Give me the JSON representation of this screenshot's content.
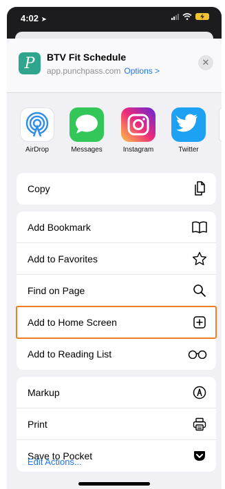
{
  "status": {
    "time": "4:02"
  },
  "header": {
    "title": "BTV Fit Schedule",
    "url": "app.punchpass.com",
    "options": "Options >",
    "app_glyph": "P",
    "close": "✕"
  },
  "share_apps": [
    {
      "label": "AirDrop",
      "icon": "airdrop-icon"
    },
    {
      "label": "Messages",
      "icon": "messages-icon"
    },
    {
      "label": "Instagram",
      "icon": "instagram-icon"
    },
    {
      "label": "Twitter",
      "icon": "twitter-icon"
    }
  ],
  "groups": [
    [
      {
        "label": "Copy",
        "icon": "copy-icon"
      }
    ],
    [
      {
        "label": "Add Bookmark",
        "icon": "book-icon"
      },
      {
        "label": "Add to Favorites",
        "icon": "star-icon"
      },
      {
        "label": "Find on Page",
        "icon": "search-icon"
      },
      {
        "label": "Add to Home Screen",
        "icon": "plus-square-icon",
        "highlighted": true
      },
      {
        "label": "Add to Reading List",
        "icon": "glasses-icon"
      }
    ],
    [
      {
        "label": "Markup",
        "icon": "markup-icon"
      },
      {
        "label": "Print",
        "icon": "printer-icon"
      },
      {
        "label": "Save to Pocket",
        "icon": "pocket-icon"
      }
    ]
  ],
  "footer": {
    "edit_actions": "Edit Actions..."
  },
  "colors": {
    "accent": "#1e73e8",
    "highlight": "#ef7d23",
    "app_icon": "#2ea58c"
  }
}
